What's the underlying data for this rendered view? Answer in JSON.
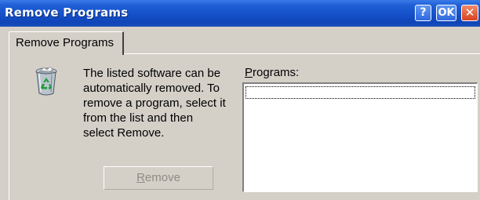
{
  "window": {
    "title": "Remove Programs",
    "help_label": "?",
    "ok_label": "OK",
    "close_label": "✕"
  },
  "tab": {
    "label": "Remove Programs"
  },
  "content": {
    "description_lines": [
      "The listed software can be",
      "automatically removed. To",
      "remove a program, select it",
      "from the list and then",
      "select Remove."
    ],
    "programs_label_accel": "P",
    "programs_label_rest": "rograms:",
    "programs": []
  },
  "remove_button": {
    "label_accel": "R",
    "label_rest": "emove",
    "enabled": false
  },
  "icon": {
    "name": "recycle-bin-icon"
  }
}
